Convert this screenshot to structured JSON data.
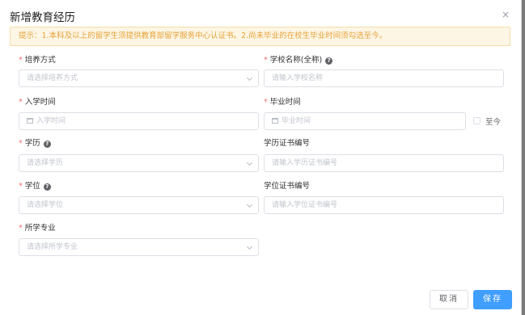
{
  "dialog": {
    "title": "新增教育经历",
    "close_glyph": "×",
    "notice": "提示：1.本科及以上的留学生须提供教育部留学服务中心认证书。2.尚未毕业的在校生毕业时间须勾选至今。"
  },
  "form": {
    "required_mark": "*",
    "help_glyph": "?",
    "training_mode": {
      "label": "培养方式",
      "placeholder": "请选择培养方式"
    },
    "school_name": {
      "label": "学校名称(全称)",
      "placeholder": "请输入学校名称"
    },
    "enroll_date": {
      "label": "入学时间",
      "placeholder": "入学时间"
    },
    "graduate_date": {
      "label": "毕业时间",
      "placeholder": "毕业时间"
    },
    "until_now": {
      "label": "至今"
    },
    "education": {
      "label": "学历",
      "placeholder": "请选择学历"
    },
    "edu_cert_no": {
      "label": "学历证书编号",
      "placeholder": "请输入学历证书编号"
    },
    "degree": {
      "label": "学位",
      "placeholder": "请选择学位"
    },
    "degree_cert_no": {
      "label": "学位证书编号",
      "placeholder": "请输入学位证书编号"
    },
    "major": {
      "label": "所学专业",
      "placeholder": "请选择所学专业"
    }
  },
  "footer": {
    "cancel_label": "取消",
    "save_label": "保存"
  }
}
